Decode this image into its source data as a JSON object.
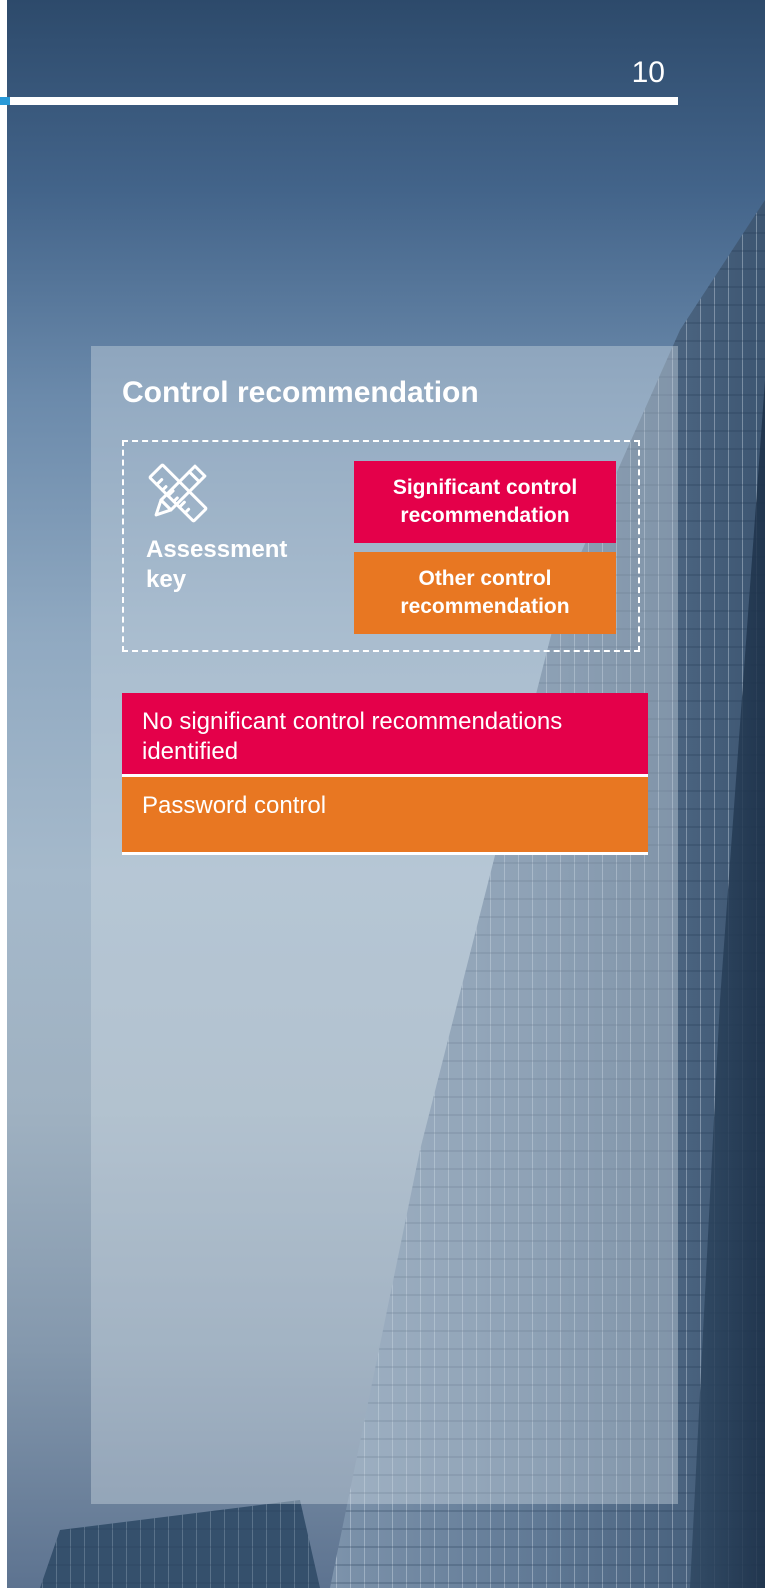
{
  "page": {
    "number": "10"
  },
  "panel": {
    "title": "Control recommendation"
  },
  "assessment_key": {
    "label": "Assessment key",
    "icon": "ruler-pencil-icon",
    "items": [
      {
        "label": "Significant control recommendation",
        "color": "#e4004a"
      },
      {
        "label": "Other control recommendation",
        "color": "#e87722"
      }
    ]
  },
  "recommendations": [
    {
      "text": "No significant control recommendations identified",
      "level": "significant",
      "color": "#e4004a"
    },
    {
      "text": "Password control",
      "level": "other",
      "color": "#e87722"
    }
  ],
  "colors": {
    "significant": "#e4004a",
    "other": "#e87722",
    "accent": "#2a9ad8"
  }
}
